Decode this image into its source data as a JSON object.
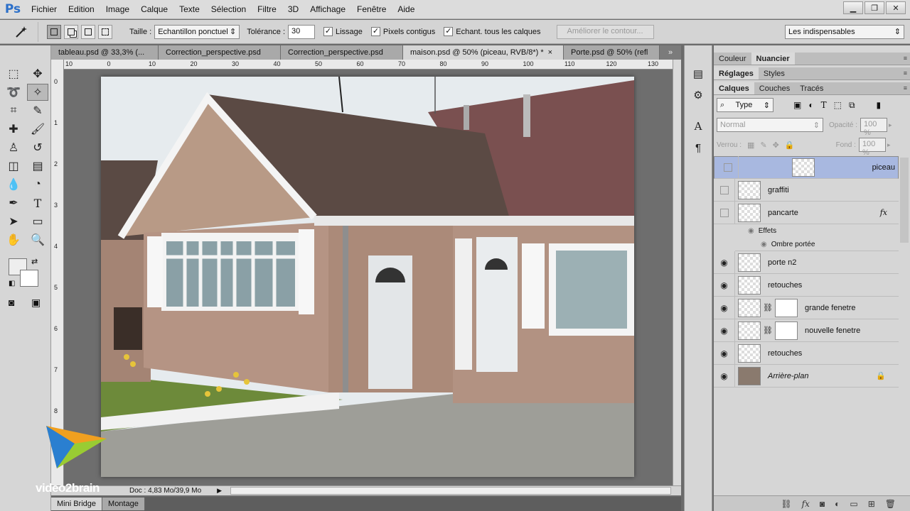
{
  "app": {
    "logo": "Ps"
  },
  "menubar": {
    "items": [
      "Fichier",
      "Edition",
      "Image",
      "Calque",
      "Texte",
      "Sélection",
      "Filtre",
      "3D",
      "Affichage",
      "Fenêtre",
      "Aide"
    ]
  },
  "window_controls": {
    "minimize": "▁",
    "restore": "❐",
    "close": "✕"
  },
  "options": {
    "size_label": "Taille :",
    "size_value": "Echantillon ponctuel",
    "tolerance_label": "Tolérance :",
    "tolerance_value": "30",
    "antialias": "Lissage",
    "contiguous": "Pixels contigus",
    "sample_all": "Echant. tous les calques",
    "refine_edge": "Améliorer le contour...",
    "workspace": "Les indispensables"
  },
  "doc_tabs": [
    {
      "label": "tableau.psd @ 33,3% (..."
    },
    {
      "label": "Correction_perspective.psd"
    },
    {
      "label": "Correction_perspective.psd"
    },
    {
      "label": "maison.psd @ 50% (piceau, RVB/8*) *",
      "close": "×"
    },
    {
      "label": "Porte.psd @ 50% (refl"
    }
  ],
  "ruler": {
    "h_marks": [
      "10",
      "0",
      "10",
      "20",
      "30",
      "40",
      "50",
      "60",
      "70",
      "80",
      "90",
      "100",
      "110",
      "120",
      "130"
    ],
    "v_marks": [
      "0",
      "1",
      "2",
      "3",
      "4",
      "5",
      "6",
      "7",
      "8"
    ]
  },
  "statusbar": {
    "doc_info": "Doc : 4,83 Mo/39,9 Mo"
  },
  "bottom_tabs": [
    "Mini Bridge",
    "Montage"
  ],
  "panels": {
    "top_tabs": [
      "Couleur",
      "Nuancier"
    ],
    "mid_tabs": [
      "Réglages",
      "Styles"
    ],
    "layer_tabs": [
      "Calques",
      "Couches",
      "Tracés"
    ],
    "filter_type": "Type",
    "blend_mode": "Normal",
    "opacity_label": "Opacité :",
    "opacity_value": "100 %",
    "lock_label": "Verrou :",
    "fill_label": "Fond :",
    "fill_value": "100 %"
  },
  "layers": [
    {
      "name": "piceau",
      "visible": false,
      "selected": true
    },
    {
      "name": "graffiti",
      "visible": false
    },
    {
      "name": "pancarte",
      "visible": false,
      "fx": "fx"
    },
    {
      "name": "porte n2",
      "visible": true
    },
    {
      "name": "retouches",
      "visible": true
    },
    {
      "name": "grande fenetre",
      "visible": true,
      "mask": true
    },
    {
      "name": "nouvelle fenetre",
      "visible": true,
      "mask": true
    },
    {
      "name": "retouches",
      "visible": true
    },
    {
      "name": "Arrière-plan",
      "visible": true,
      "locked": true
    }
  ],
  "effects": {
    "label": "Effets",
    "shadow": "Ombre portée"
  },
  "watermark": {
    "text": "video2brain"
  }
}
